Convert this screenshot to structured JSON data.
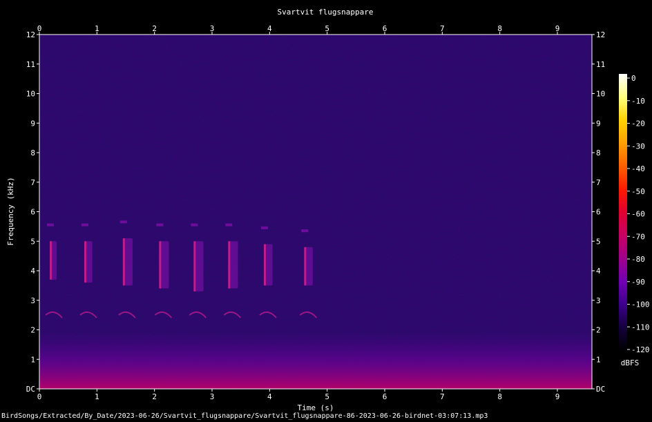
{
  "chart_data": {
    "type": "heatmap",
    "title": "Svartvit flugsnappare",
    "xlabel": "Time (s)",
    "ylabel": "Frequency (kHz)",
    "xlim": [
      0,
      9.6
    ],
    "ylim": [
      0,
      12
    ],
    "x_ticks": [
      "0",
      "1",
      "2",
      "3",
      "4",
      "5",
      "6",
      "7",
      "8",
      "9"
    ],
    "y_ticks": [
      "DC",
      "1",
      "2",
      "3",
      "4",
      "5",
      "6",
      "7",
      "8",
      "9",
      "10",
      "11",
      "12"
    ],
    "colorbar": {
      "label": "dBFS",
      "ticks": [
        "0",
        "-10",
        "-20",
        "-30",
        "-40",
        "-50",
        "-60",
        "-70",
        "-80",
        "-90",
        "-100",
        "-110",
        "-120"
      ],
      "colors": [
        "#ffffff",
        "#ffff80",
        "#ffd200",
        "#ffa000",
        "#ff6000",
        "#ff1a00",
        "#e00030",
        "#c80064",
        "#a0008c",
        "#7000b4",
        "#3c008c",
        "#14003c",
        "#000000"
      ]
    },
    "background_level_dbfs": -105,
    "calls": [
      {
        "t_start": 0.18,
        "t_end": 0.3,
        "f_low": 3.7,
        "f_high": 5.0
      },
      {
        "t_start": 0.78,
        "t_end": 0.92,
        "f_low": 3.6,
        "f_high": 5.0
      },
      {
        "t_start": 1.45,
        "t_end": 1.62,
        "f_low": 3.5,
        "f_high": 5.1
      },
      {
        "t_start": 2.08,
        "t_end": 2.25,
        "f_low": 3.4,
        "f_high": 5.0
      },
      {
        "t_start": 2.68,
        "t_end": 2.85,
        "f_low": 3.3,
        "f_high": 5.0
      },
      {
        "t_start": 3.28,
        "t_end": 3.45,
        "f_low": 3.4,
        "f_high": 5.0
      },
      {
        "t_start": 3.9,
        "t_end": 4.05,
        "f_low": 3.5,
        "f_high": 4.9
      },
      {
        "t_start": 4.6,
        "t_end": 4.75,
        "f_low": 3.5,
        "f_high": 4.8
      }
    ]
  },
  "footer": {
    "path": "BirdSongs/Extracted/By_Date/2023-06-26/Svartvit_flugsnappare/Svartvit_flugsnappare-86-2023-06-26-birdnet-03:07:13.mp3"
  }
}
